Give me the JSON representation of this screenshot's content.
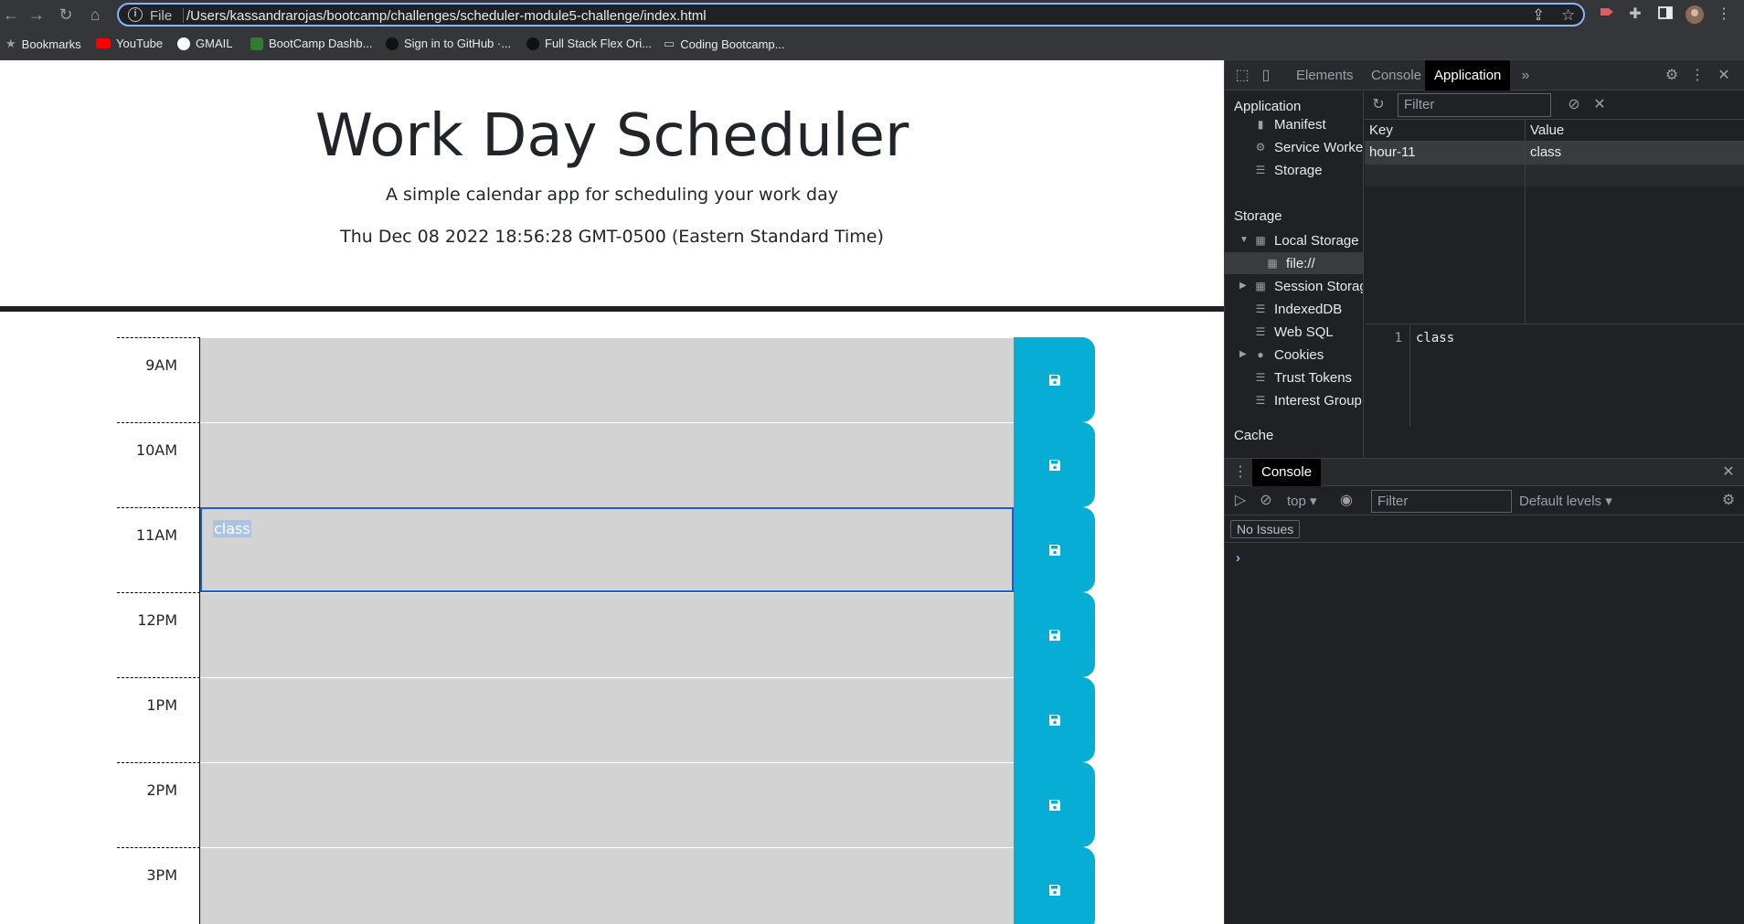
{
  "browser": {
    "back": "←",
    "forward": "→",
    "reload": "↻",
    "home": "⌂",
    "scheme_label": "File",
    "url": "/Users/kassandrarojas/bootcamp/challenges/scheduler-module5-challenge/index.html",
    "bookmarks": [
      {
        "label": "Bookmarks",
        "icon": "star-icon"
      },
      {
        "label": "YouTube",
        "icon": "youtube-icon"
      },
      {
        "label": "GMAIL",
        "icon": "google-icon"
      },
      {
        "label": "BootCamp Dashb...",
        "icon": "site-icon"
      },
      {
        "label": "Sign in to GitHub ·...",
        "icon": "github-icon"
      },
      {
        "label": "Full Stack Flex Ori...",
        "icon": "github-icon"
      },
      {
        "label": "Coding Bootcamp...",
        "icon": "folder-icon"
      }
    ]
  },
  "page": {
    "title": "Work Day Scheduler",
    "lead": "A simple calendar app for scheduling your work day",
    "current_day": "Thu Dec 08 2022 18:56:28 GMT-0500 (Eastern Standard Time)",
    "colors": {
      "past": "#d3d3d3",
      "save": "#06aed5"
    },
    "hours": [
      {
        "label": "9AM",
        "text": ""
      },
      {
        "label": "10AM",
        "text": ""
      },
      {
        "label": "11AM",
        "text": "class"
      },
      {
        "label": "12PM",
        "text": ""
      },
      {
        "label": "1PM",
        "text": ""
      },
      {
        "label": "2PM",
        "text": ""
      },
      {
        "label": "3PM",
        "text": ""
      }
    ]
  },
  "devtools": {
    "tabs": [
      "Elements",
      "Console",
      "Application"
    ],
    "active_tab": "Application",
    "sidebar": {
      "application_header": "Application",
      "application_items": [
        "Manifest",
        "Service Worke",
        "Storage"
      ],
      "storage_header": "Storage",
      "storage_items": [
        "Local Storage",
        "file://",
        "Session Storag",
        "IndexedDB",
        "Web SQL",
        "Cookies",
        "Trust Tokens",
        "Interest Group"
      ],
      "cache_header": "Cache"
    },
    "filter_placeholder": "Filter",
    "table": {
      "headers": [
        "Key",
        "Value"
      ],
      "rows": [
        {
          "key": "hour-11",
          "value": "class"
        }
      ]
    },
    "preview": {
      "line": "1",
      "value": "class"
    },
    "drawer": {
      "tab": "Console",
      "context": "top",
      "filter_placeholder": "Filter",
      "levels": "Default levels",
      "issues": "No Issues",
      "prompt": "›"
    }
  }
}
